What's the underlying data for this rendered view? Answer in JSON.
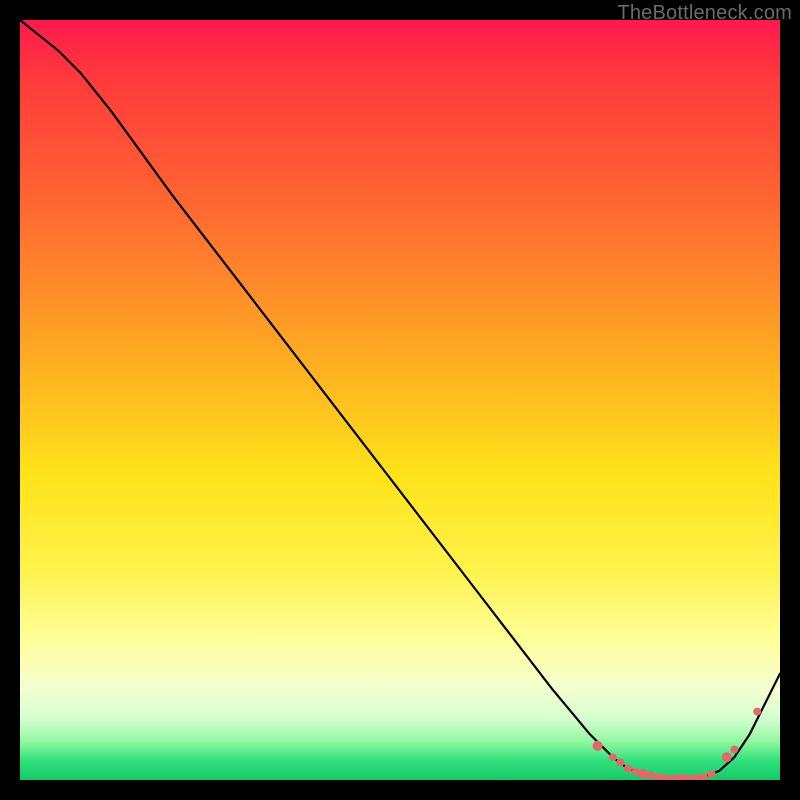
{
  "watermark": "TheBottleneck.com",
  "colors": {
    "background": "#000000",
    "curve": "#000000",
    "marker": "#e06a6a",
    "gradient_stops": [
      "#ff1a4d",
      "#ff3b3b",
      "#ff5a34",
      "#ff8a2a",
      "#ffb91f",
      "#ffe31a",
      "#fff24a",
      "#ffff9e",
      "#f4ffcf",
      "#d4ffcf",
      "#8ff7a0",
      "#2fe07a",
      "#17c96a"
    ]
  },
  "chart_data": {
    "type": "line",
    "title": "",
    "xlabel": "",
    "ylabel": "",
    "xlim": [
      0,
      100
    ],
    "ylim": [
      0,
      100
    ],
    "grid": false,
    "legend": false,
    "series": [
      {
        "name": "bottleneck-curve",
        "x": [
          0,
          5,
          8,
          12,
          20,
          30,
          40,
          50,
          60,
          70,
          75,
          78,
          80,
          82,
          84,
          86,
          88,
          90,
          92,
          94,
          96,
          100
        ],
        "y": [
          100,
          96,
          93,
          88,
          77,
          64,
          51,
          38,
          25,
          12,
          6,
          3,
          1.5,
          0.8,
          0.4,
          0.2,
          0.2,
          0.4,
          1.2,
          3,
          6,
          14
        ]
      }
    ],
    "markers": {
      "name": "highlight-dots",
      "x": [
        76,
        78,
        79,
        80,
        81,
        82,
        83,
        84,
        85,
        86,
        87,
        88,
        89,
        90,
        91,
        93,
        94,
        97
      ],
      "y": [
        4.5,
        3,
        2.3,
        1.5,
        1.1,
        0.8,
        0.6,
        0.4,
        0.3,
        0.2,
        0.2,
        0.2,
        0.3,
        0.4,
        0.8,
        3,
        4,
        9
      ]
    }
  }
}
